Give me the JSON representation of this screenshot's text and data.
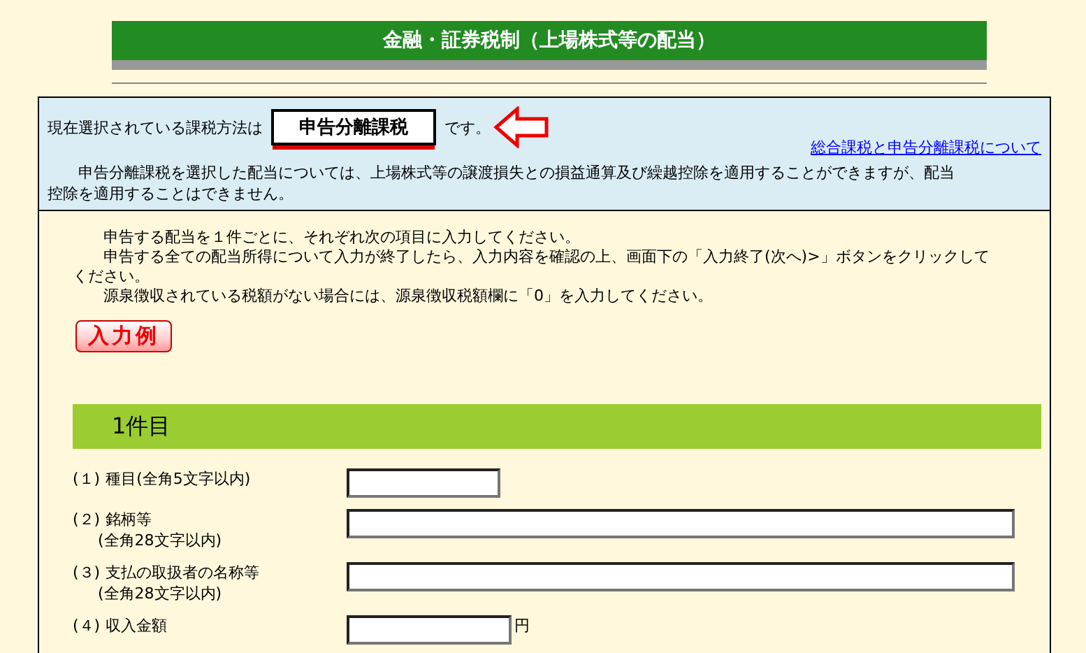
{
  "page_title": "金融・証券税制（上場株式等の配当）",
  "method": {
    "prefix": "現在選択されている課税方法は",
    "value": "申告分離課税",
    "suffix": "です。",
    "link": "総合課税と申告分離課税について",
    "note": "申告分離課税を選択した配当については、上場株式等の譲渡損失との損益通算及び繰越控除を適用することができますが、配当控除を適用することはできません。"
  },
  "instructions": [
    "申告する配当を１件ごとに、それぞれ次の項目に入力してください。",
    "申告する全ての配当所得について入力が終了したら、入力内容を確認の上、画面下の「入力終了(次へ)>」ボタンをクリックしてください。",
    "源泉徴収されている税額がない場合には、源泉徴収税額欄に「0」を入力してください。"
  ],
  "example_button": "入力例",
  "section_title": "1件目",
  "fields": [
    {
      "number": "(１)",
      "label": "種目(全角5文字以内)",
      "kind": "short"
    },
    {
      "number": "(２)",
      "label": "銘柄等",
      "hint": "(全角28文字以内)",
      "kind": "long"
    },
    {
      "number": "(３)",
      "label": "支払の取扱者の名称等",
      "hint": "(全角28文字以内)",
      "kind": "long"
    },
    {
      "number": "(４)",
      "label": "収入金額",
      "kind": "amount",
      "unit": "円"
    }
  ]
}
